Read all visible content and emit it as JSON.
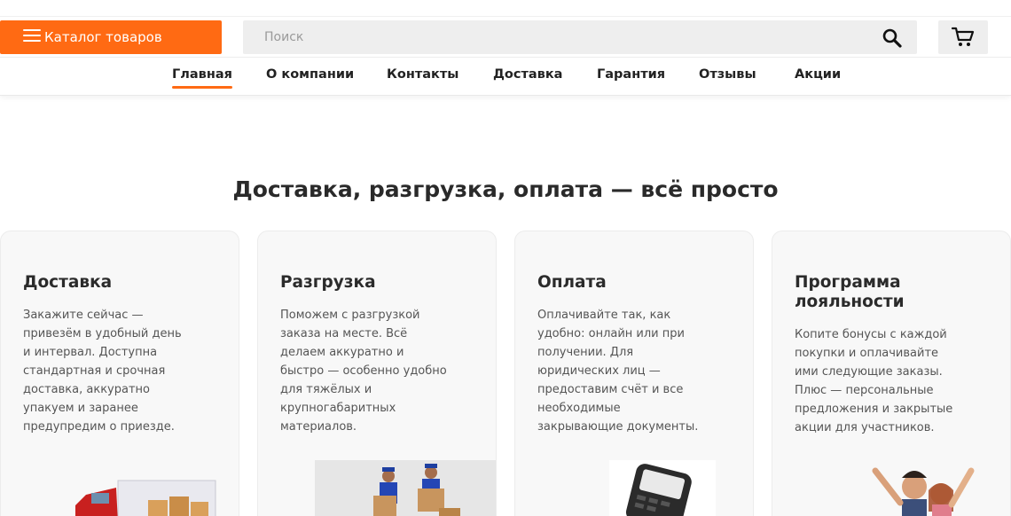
{
  "header": {
    "catalog_label": "Каталог товаров",
    "search_placeholder": "Поиск",
    "accent_color": "#ff6a13"
  },
  "nav": {
    "items": [
      {
        "label": "Главная",
        "active": true
      },
      {
        "label": "О компании"
      },
      {
        "label": "Контакты"
      },
      {
        "label": "Доставка"
      },
      {
        "label": "Гарантия"
      },
      {
        "label": "Отзывы"
      },
      {
        "label": "Акции"
      }
    ]
  },
  "main": {
    "title": "Доставка, разгрузка, оплата — всё просто",
    "cards": [
      {
        "title": "Доставка",
        "text": "Закажите сейчас — привезём в удобный день и интервал. Доступна стандартная и срочная доставка, аккуратно упакуем и заранее предупредим о приезде.",
        "image": "delivery-truck-image"
      },
      {
        "title": "Разгрузка",
        "text": "Поможем с разгрузкой заказа на месте. Всё делаем аккуратно и быстро — особенно удобно для тяжёлых и крупногабаритных материалов.",
        "image": "movers-with-boxes-image"
      },
      {
        "title": "Оплата",
        "text": "Оплачивайте так, как удобно: онлайн или при получении. Для юридических лиц — предоставим счёт и все необходимые закрывающие документы.",
        "image": "payment-terminal-image"
      },
      {
        "title": "Программа лояльности",
        "text": "Копите бонусы с каждой покупки и оплачивайте ими следующие заказы. Плюс — персональные предложения и закрытые акции для участников.",
        "image": "happy-customers-image"
      }
    ]
  }
}
